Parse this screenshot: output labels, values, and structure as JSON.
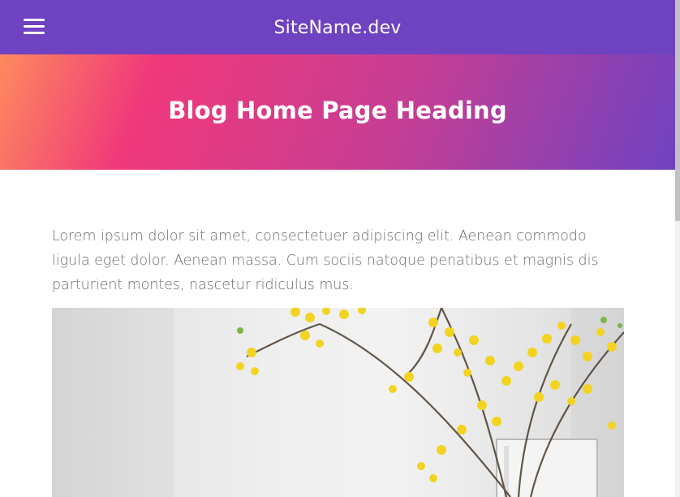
{
  "navbar": {
    "brand": "SiteName.dev",
    "menu_icon": "hamburger-menu-icon",
    "background": "#6f42c1"
  },
  "hero": {
    "heading": "Blog Home Page Heading",
    "gradient": [
      "#fd8a5e",
      "#f0387a",
      "#c43e95",
      "#6f42c1"
    ]
  },
  "content": {
    "intro": "Lorem ipsum dolor sit amet, consectetuer adipiscing elit. Aenean commodo ligula eget dolor. Aenean massa. Cum sociis natoque penatibus et magnis dis parturient montes, nascetur ridiculus mus."
  },
  "image": {
    "subject": "yellow-forsythia-flowers-in-glass-vase"
  }
}
